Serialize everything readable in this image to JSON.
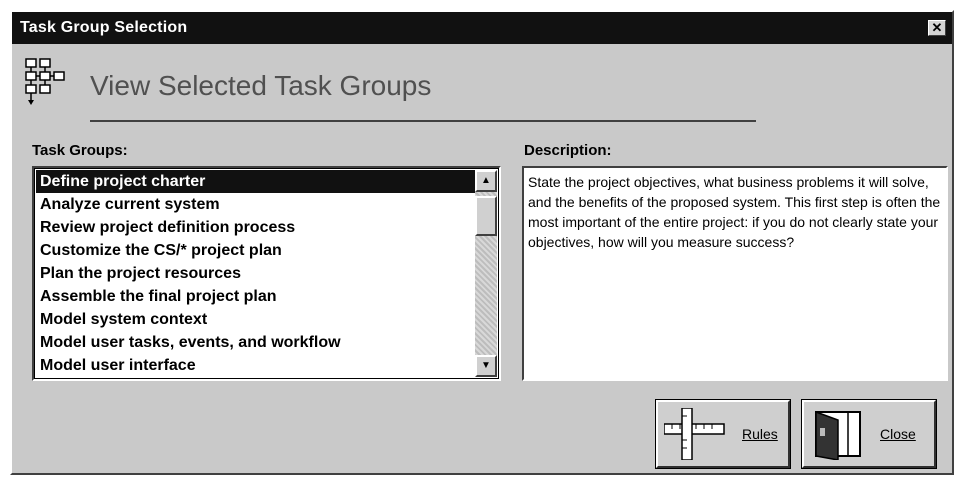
{
  "window": {
    "title": "Task Group Selection",
    "close_glyph": "✕"
  },
  "header": {
    "title": "View Selected Task Groups",
    "icon": "task-network-icon"
  },
  "task_groups": {
    "label": "Task Groups:",
    "selected_index": 0,
    "items": [
      "Define project charter",
      "Analyze current system",
      "Review project definition process",
      "Customize the CS/* project plan",
      "Plan the project resources",
      "Assemble the final project plan",
      "Model system context",
      "Model user tasks, events, and workflow",
      "Model user interface"
    ],
    "scroll_up_glyph": "▲",
    "scroll_down_glyph": "▼"
  },
  "description": {
    "label": "Description:",
    "text": "State the project objectives, what business problems it will solve, and the benefits of the proposed system.  This first step is often the most important of the entire project:  if you do not clearly state your objectives, how will you measure success?"
  },
  "buttons": {
    "rules_label": "Rules",
    "rules_icon": "ruler-icon",
    "close_label": "Close",
    "close_icon": "door-icon"
  }
}
